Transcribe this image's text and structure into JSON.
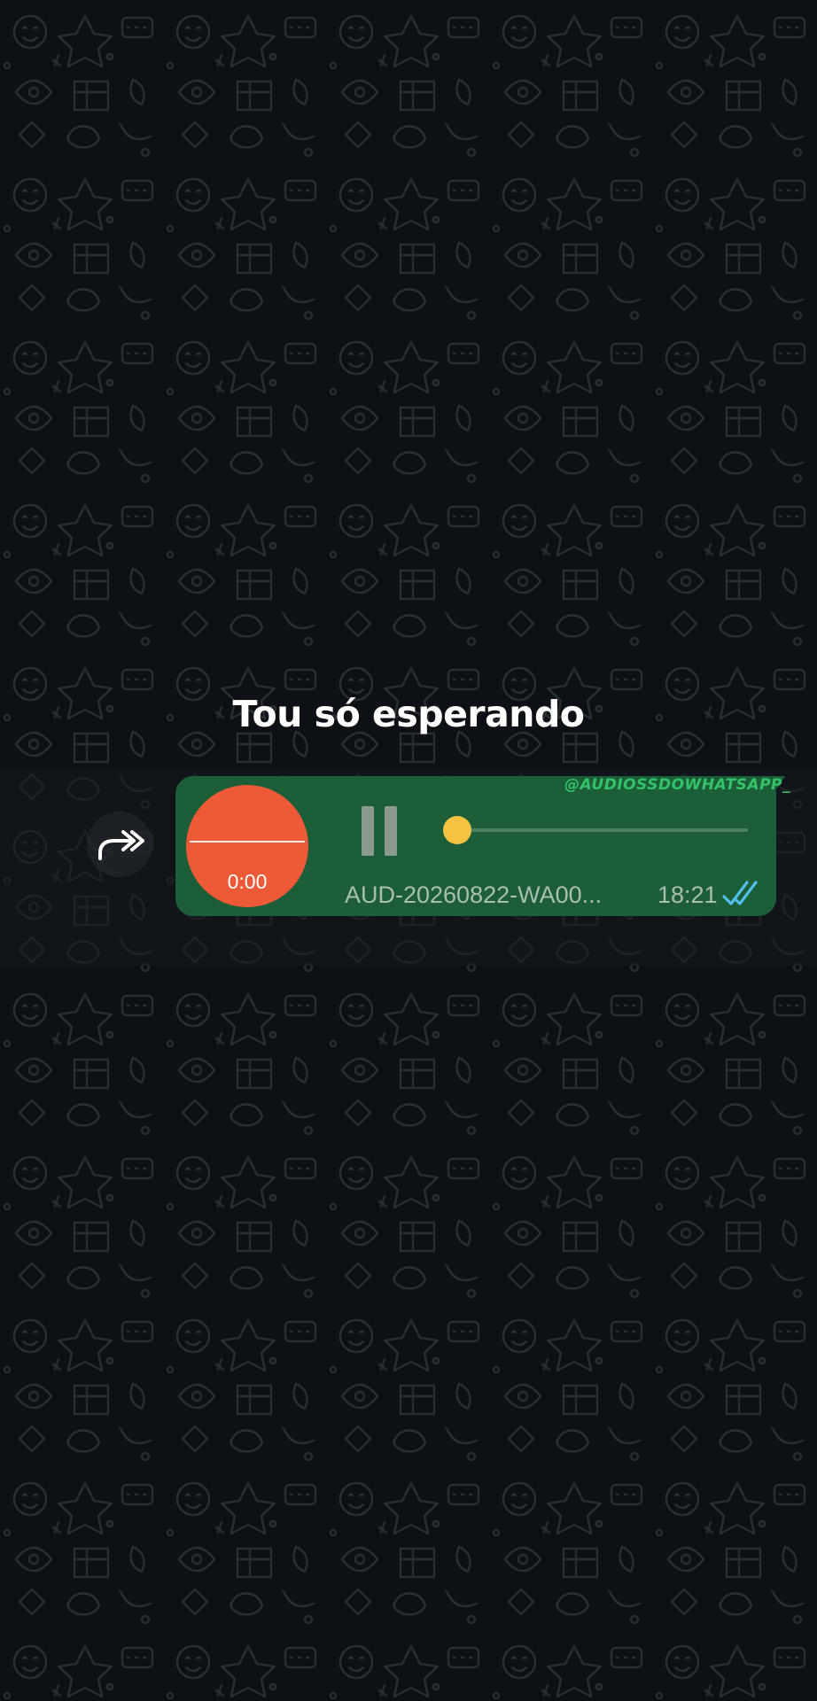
{
  "caption": "Tou só esperando",
  "watermark": "@AUDIOSSDOWHATSAPP_",
  "voice_message": {
    "duration": "0:00",
    "filename": "AUD-20260822-WA00...",
    "time": "18:21",
    "playback_progress": 0.03,
    "state": "pause-icon",
    "read_status": "double-check-read-icon"
  },
  "icons": {
    "forward": "forward-icon"
  },
  "colors": {
    "bubble": "#1b5e38",
    "avatar": "#ee5a38",
    "thumb": "#f5c242",
    "ticks": "#53bdeb",
    "watermark": "#34c26a"
  }
}
